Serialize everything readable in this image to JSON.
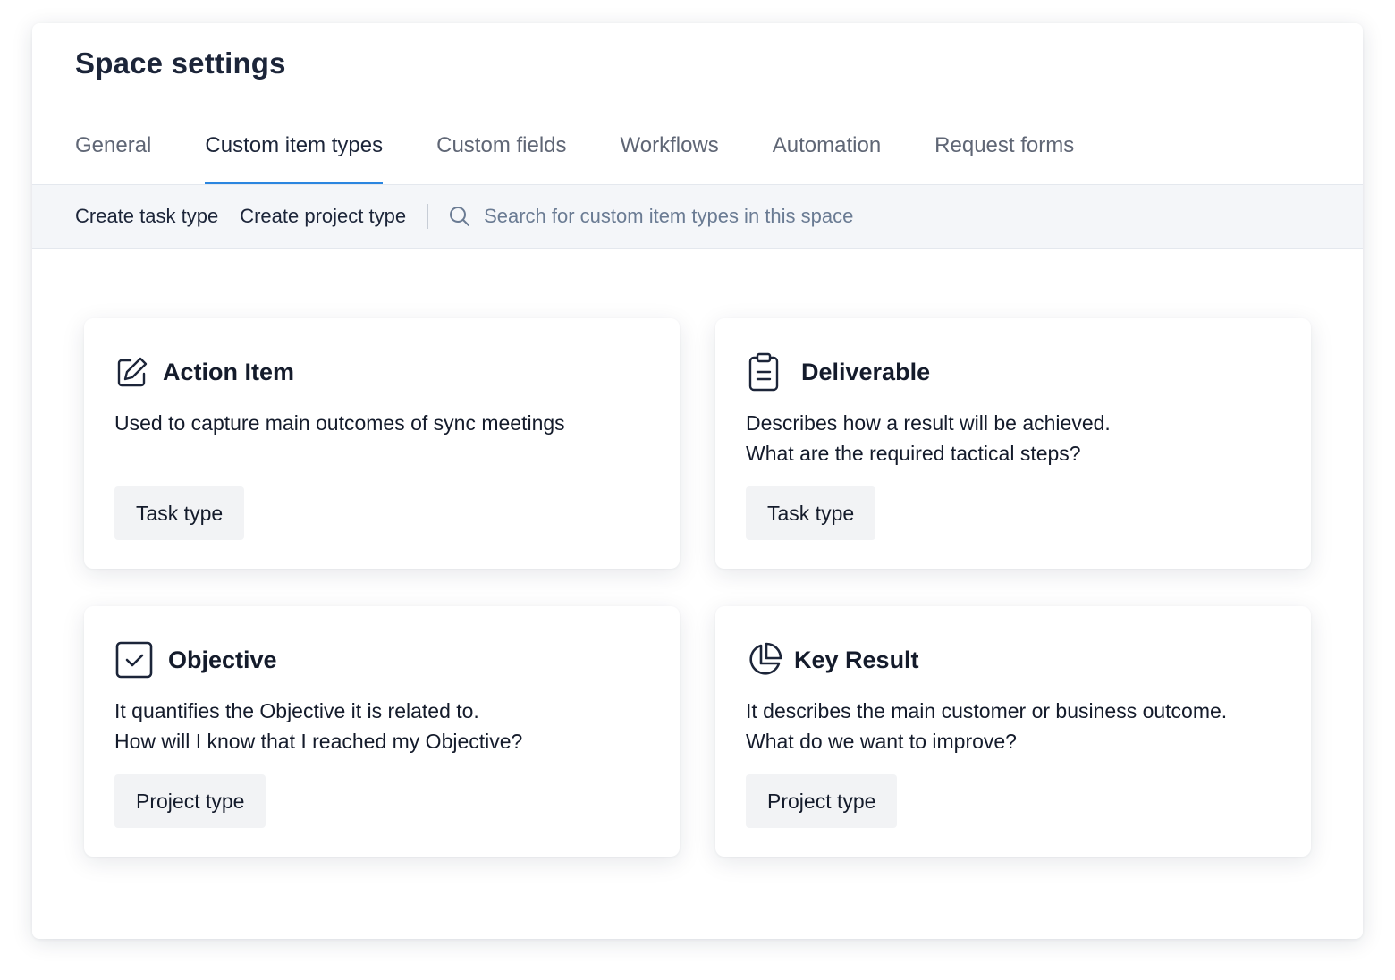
{
  "page": {
    "title": "Space settings"
  },
  "tabs": [
    {
      "label": "General",
      "active": false
    },
    {
      "label": "Custom item types",
      "active": true
    },
    {
      "label": "Custom fields",
      "active": false
    },
    {
      "label": "Workflows",
      "active": false
    },
    {
      "label": "Automation",
      "active": false
    },
    {
      "label": "Request forms",
      "active": false
    }
  ],
  "toolbar": {
    "create_task_label": "Create task type",
    "create_project_label": "Create project type",
    "search_placeholder": "Search for custom item types in this space"
  },
  "cards": [
    {
      "title": "Action Item",
      "icon": "edit-icon",
      "description": [
        "Used to capture main outcomes of sync meetings"
      ],
      "type_label": "Task type"
    },
    {
      "title": "Deliverable",
      "icon": "clipboard-icon",
      "description": [
        "Describes how a result will be achieved.",
        "What are the required tactical steps?"
      ],
      "type_label": "Task type"
    },
    {
      "title": "Objective",
      "icon": "checkbox-icon",
      "description": [
        "It quantifies the Objective it is related to.",
        "How will I know that I reached my Objective?"
      ],
      "type_label": "Project type"
    },
    {
      "title": "Key Result",
      "icon": "pie-chart-icon",
      "description": [
        "It describes the main customer or business outcome.",
        "What do we want to improve?"
      ],
      "type_label": "Project type"
    }
  ],
  "colors": {
    "accent": "#2b86e0",
    "toolbar_bg": "#f4f6f9",
    "badge_bg": "#f2f3f5",
    "text_dark": "#1c2539"
  }
}
